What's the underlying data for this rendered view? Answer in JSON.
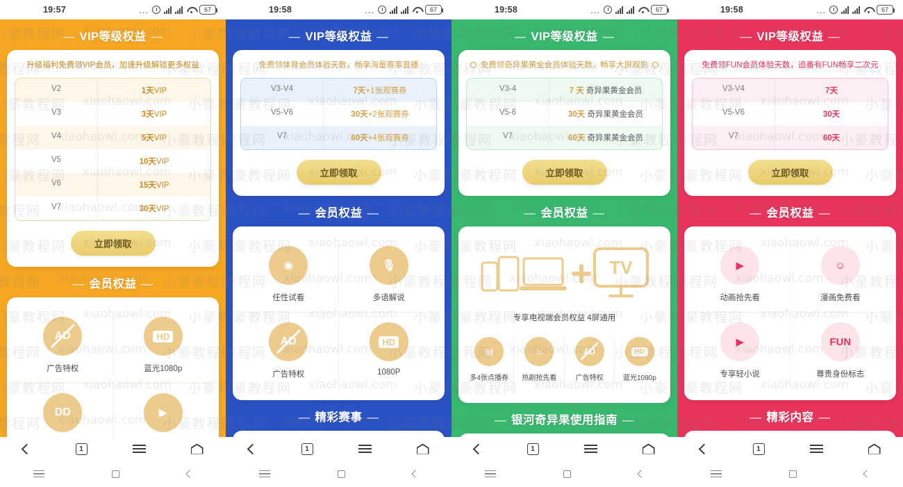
{
  "status_bar": {
    "time_orange": "19:57",
    "time_other": "19:58",
    "battery": "67",
    "dots": "...",
    "icons": [
      "alarm-icon",
      "signal-icon",
      "signal-icon",
      "wifi-icon",
      "battery-icon"
    ]
  },
  "browser_nav": {
    "back": "back-chevron",
    "tab_count": "1",
    "menu": "menu-icon",
    "home": "home-icon"
  },
  "screens": [
    {
      "id": "vip-orange",
      "theme": "#f5a623",
      "accent_text": "#c98a22",
      "table_border": "#f0d9a8",
      "table_bg": "#fdf6e9",
      "title": "VIP等级权益",
      "subtitle": "升级福利免费领VIP会员，加速升级解锁更多权益",
      "rows": [
        {
          "level": "V2",
          "reward_num": "1天",
          "reward_text": "VIP"
        },
        {
          "level": "V3",
          "reward_num": "3天",
          "reward_text": "VIP"
        },
        {
          "level": "V4",
          "reward_num": "5天",
          "reward_text": "VIP"
        },
        {
          "level": "V5",
          "reward_num": "10天",
          "reward_text": "VIP"
        },
        {
          "level": "V6",
          "reward_num": "15天",
          "reward_text": "VIP"
        },
        {
          "level": "V7",
          "reward_num": "30天",
          "reward_text": "VIP"
        }
      ],
      "claim_label": "立即领取",
      "benefits_title": "会员权益",
      "benefits_layout": "grid2",
      "benefits": [
        {
          "icon": "no-ad-icon",
          "glyph": "AD",
          "label": "广告特权"
        },
        {
          "icon": "hd-icon",
          "glyph": "HD",
          "label": "蓝光1080p"
        },
        {
          "icon": "dolby-icon",
          "glyph": "DD",
          "label": ""
        },
        {
          "icon": "play-icon",
          "glyph": "▶",
          "label": ""
        }
      ],
      "next_section": ""
    },
    {
      "id": "vip-blue",
      "theme": "#2b52c4",
      "accent_text": "#d3a04a",
      "table_border": "#bcd3f0",
      "table_bg": "#e8f1fc",
      "title": "VIP等级权益",
      "subtitle": "免费领体育会员体验天数，畅享海量赛事直播",
      "rows": [
        {
          "level": "V3-V4",
          "reward_num": "7天",
          "reward_text": "+1张观赛券"
        },
        {
          "level": "V5-V6",
          "reward_num": "30天",
          "reward_text": "+2张观赛券"
        },
        {
          "level": "V7",
          "reward_num": "60天",
          "reward_text": "+4张观赛券"
        }
      ],
      "claim_label": "立即领取",
      "benefits_title": "会员权益",
      "benefits_layout": "grid2",
      "benefits": [
        {
          "icon": "eye-preview-icon",
          "glyph": "◉",
          "label": "任性试看"
        },
        {
          "icon": "microphone-icon",
          "glyph": "🎙",
          "label": "多语解说"
        },
        {
          "icon": "no-ad-icon",
          "glyph": "AD",
          "label": "广告特权"
        },
        {
          "icon": "hd-icon",
          "glyph": "HD",
          "label": "1080P"
        }
      ],
      "next_section": "精彩赛事"
    },
    {
      "id": "vip-green",
      "theme": "#38b86e",
      "accent_text": "#d3a04a",
      "table_border": "#bfe6cd",
      "table_bg": "#eef9f2",
      "title": "VIP等级权益",
      "subtitle": "免费领奇异果黄金会员体验天数，畅享大屏观影",
      "subtitle_icons": true,
      "rows": [
        {
          "level": "V3-4",
          "reward_num": "7 天",
          "reward_text": "奇异果黄金会员"
        },
        {
          "level": "V5-6",
          "reward_num": "30天",
          "reward_text": "奇异果黄金会员"
        },
        {
          "level": "V7",
          "reward_num": "60天",
          "reward_text": "奇异果黄金会员"
        }
      ],
      "claim_label": "立即领取",
      "benefits_title": "会员权益",
      "benefits_layout": "tv",
      "tv_caption": "专享电视端会员权益  4屏通用",
      "benefits": [
        {
          "icon": "ticket-icon",
          "glyph": "▤",
          "label": "多4张点播券"
        },
        {
          "icon": "flame-icon",
          "glyph": "♨",
          "label": "热剧抢先看"
        },
        {
          "icon": "no-ad-icon",
          "glyph": "AD",
          "label": "广告特权"
        },
        {
          "icon": "hd-icon",
          "glyph": "HD",
          "label": "蓝光1080p"
        }
      ],
      "next_section": "银河奇异果使用指南"
    },
    {
      "id": "vip-pink",
      "theme": "#e8345c",
      "accent_text": "#e8345c",
      "table_border": "#f6c3cf",
      "table_bg": "#fdeef2",
      "title": "VIP等级权益",
      "subtitle": "免费领FUN会员体验天数，追番有FUN畅享二次元",
      "rows": [
        {
          "level": "V3-V4",
          "reward_num": "7天",
          "reward_text": ""
        },
        {
          "level": "V5-V6",
          "reward_num": "30天",
          "reward_text": ""
        },
        {
          "level": "V7",
          "reward_num": "60天",
          "reward_text": ""
        }
      ],
      "claim_label": "立即领取",
      "benefits_title": "会员权益",
      "benefits_layout": "grid2-pink",
      "benefits": [
        {
          "icon": "anime-play-icon",
          "glyph": "▶",
          "label": "动画抢先看"
        },
        {
          "icon": "comic-character-icon",
          "glyph": "☺",
          "label": "漫画免费看"
        },
        {
          "icon": "novel-play-icon",
          "glyph": "▶",
          "label": "专享轻小说"
        },
        {
          "icon": "fun-badge-icon",
          "glyph": "FUN",
          "label": "尊贵身份标志"
        }
      ],
      "next_section": "精彩内容"
    }
  ],
  "watermark": {
    "cn": "小豪教程网",
    "en": "xiaohaowl.com"
  }
}
